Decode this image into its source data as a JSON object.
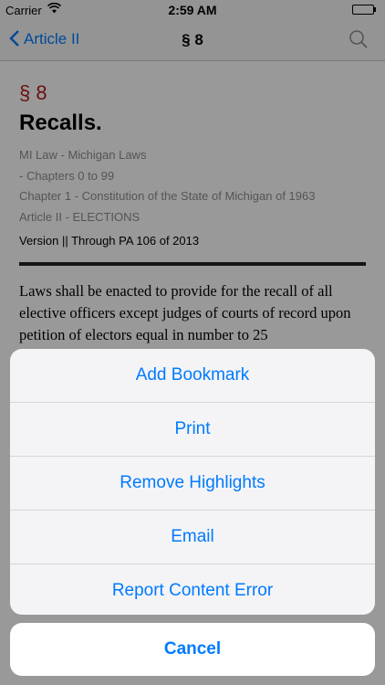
{
  "status": {
    "carrier": "Carrier",
    "time": "2:59 AM"
  },
  "nav": {
    "back_label": "Article II",
    "title": "§ 8"
  },
  "document": {
    "section": "§ 8",
    "heading": "Recalls.",
    "breadcrumb": [
      "MI Law - Michigan Laws",
      "- Chapters 0 to 99",
      "Chapter 1 - Constitution of the State of Michigan of 1963",
      "Article II - ELECTIONS"
    ],
    "version": "Version || Through PA 106 of 2013",
    "body": "Laws shall be enacted to provide for the recall of all elective officers except judges of courts of record upon petition of electors equal in number to 25"
  },
  "sheet": {
    "items": [
      "Add Bookmark",
      "Print",
      "Remove Highlights",
      "Email",
      "Report Content Error"
    ],
    "cancel": "Cancel"
  }
}
